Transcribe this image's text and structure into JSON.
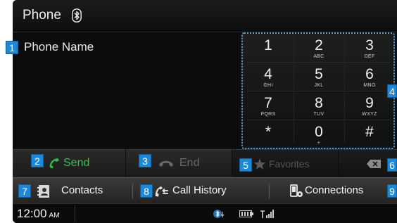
{
  "header": {
    "title": "Phone",
    "bluetooth_icon": "bluetooth-icon"
  },
  "phone_name": "Phone Name",
  "keypad": {
    "keys": [
      {
        "digit": "1",
        "letters": ""
      },
      {
        "digit": "2",
        "letters": "ABC"
      },
      {
        "digit": "3",
        "letters": "DEF"
      },
      {
        "digit": "4",
        "letters": "GHI"
      },
      {
        "digit": "5",
        "letters": "JKL"
      },
      {
        "digit": "6",
        "letters": "MNO"
      },
      {
        "digit": "7",
        "letters": "PQRS"
      },
      {
        "digit": "8",
        "letters": "TUV"
      },
      {
        "digit": "9",
        "letters": "WXYZ"
      },
      {
        "digit": "*",
        "letters": ""
      },
      {
        "digit": "0",
        "letters": "+"
      },
      {
        "digit": "#",
        "letters": ""
      }
    ]
  },
  "actions": {
    "send_label": "Send",
    "end_label": "End",
    "favorites_label": "Favorites"
  },
  "tabs": {
    "contacts": "Contacts",
    "call_history": "Call History",
    "connections": "Connections"
  },
  "status": {
    "time": "12:00",
    "ampm": "AM"
  },
  "callouts": [
    "1",
    "2",
    "3",
    "4",
    "5",
    "6",
    "7",
    "8",
    "9"
  ],
  "colors": {
    "send_green": "#2fc24a",
    "end_gray": "#6a6a6a",
    "callout_blue": "#1e88d6",
    "keypad_border": "#4aa6e6"
  }
}
